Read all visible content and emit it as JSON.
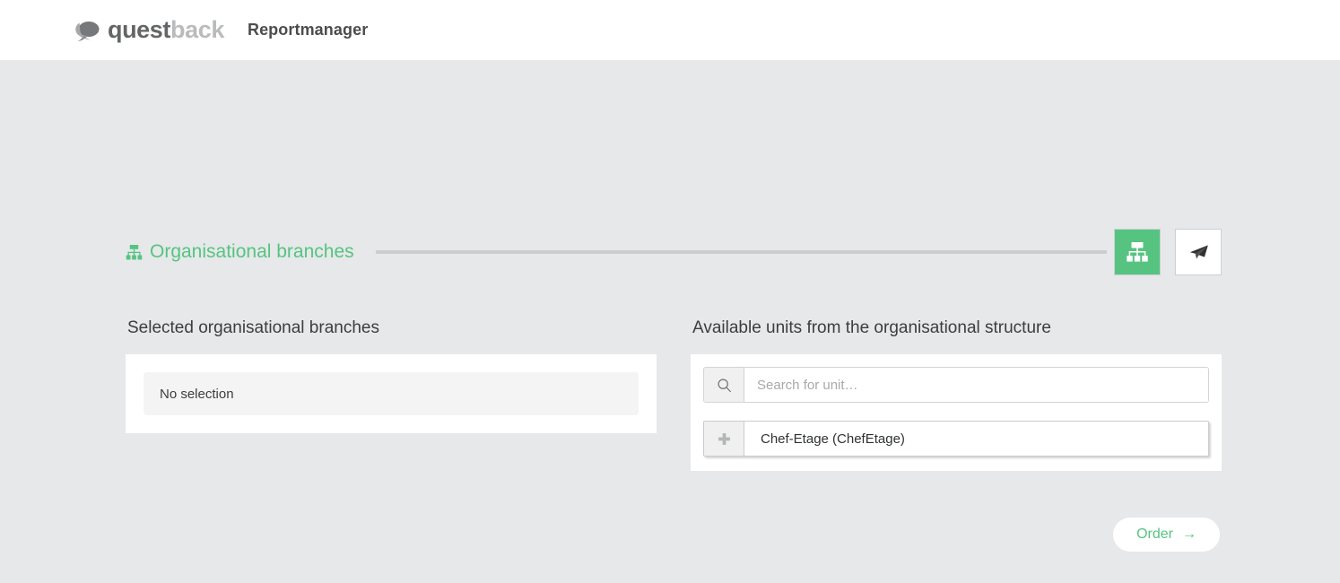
{
  "header": {
    "logo": {
      "icon": "speech-bubble-icon",
      "word_dark": "quest",
      "word_light": "back"
    },
    "app_name": "Reportmanager"
  },
  "stepper": {
    "current_step": {
      "icon": "sitemap-icon",
      "label": "Organisational branches"
    },
    "steps": [
      {
        "icon": "sitemap-icon",
        "name": "organisational-branches",
        "active": true
      },
      {
        "icon": "paper-plane-icon",
        "name": "send",
        "active": false
      }
    ]
  },
  "selected_panel": {
    "heading": "Selected organisational branches",
    "empty_text": "No selection"
  },
  "available_panel": {
    "heading": "Available units from the organisational structure",
    "search": {
      "icon": "search-icon",
      "value": "",
      "placeholder": "Search for unit…"
    },
    "units": [
      {
        "add_icon": "plus-icon",
        "label": "Chef-Etage (ChefEtage)"
      }
    ]
  },
  "footer": {
    "order_label": "Order",
    "order_arrow": "→"
  },
  "colors": {
    "accent_green": "#56c480",
    "page_background": "#e6e8ea",
    "card_background": "#ffffff",
    "muted_text": "#a7a9ab",
    "line_gray": "#cbcdcf"
  }
}
